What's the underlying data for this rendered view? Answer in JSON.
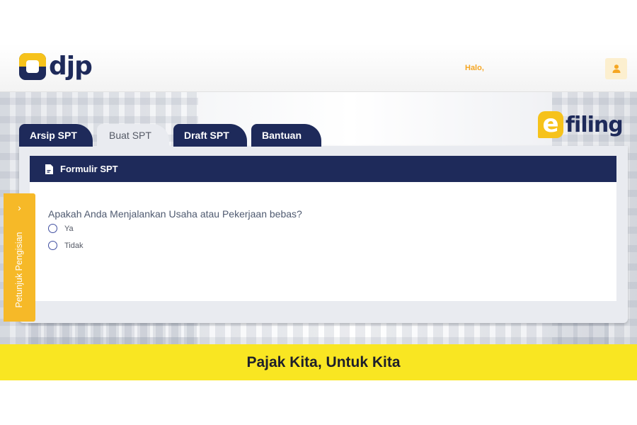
{
  "header": {
    "logo_text": "djp",
    "greeting": "Halo,",
    "user_icon": "user-icon"
  },
  "brand": {
    "efiling_letter": "e",
    "efiling_word": "filing"
  },
  "tabs": [
    {
      "label": "Arsip SPT",
      "active": true
    },
    {
      "label": "Buat SPT",
      "active": false
    },
    {
      "label": "Draft SPT",
      "active": true
    },
    {
      "label": "Bantuan",
      "active": true
    }
  ],
  "form": {
    "title": "Formulir SPT",
    "title_icon": "document-icon",
    "question": "Apakah Anda Menjalankan Usaha atau Pekerjaan bebas?",
    "options": [
      {
        "label": "Ya",
        "selected": false
      },
      {
        "label": "Tidak",
        "selected": false
      }
    ]
  },
  "guide": {
    "label": "Petunjuk Pengisian",
    "chevron": "›"
  },
  "footer": {
    "tagline": "Pajak Kita, Untuk Kita"
  },
  "colors": {
    "navy": "#1e2a5a",
    "accent_yellow": "#f6c21b",
    "footer_yellow": "#f9e622",
    "guide_orange": "#f6b928"
  }
}
